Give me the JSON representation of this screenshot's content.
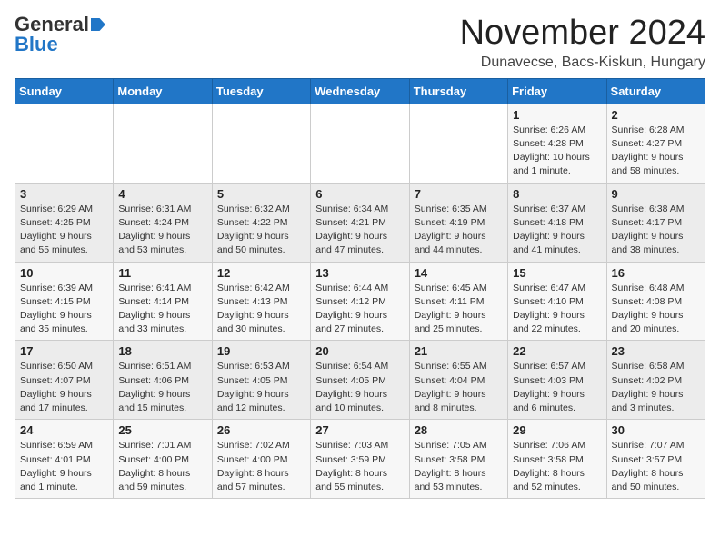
{
  "header": {
    "logo_general": "General",
    "logo_blue": "Blue",
    "month_title": "November 2024",
    "location": "Dunavecse, Bacs-Kiskun, Hungary"
  },
  "calendar": {
    "days_of_week": [
      "Sunday",
      "Monday",
      "Tuesday",
      "Wednesday",
      "Thursday",
      "Friday",
      "Saturday"
    ],
    "weeks": [
      [
        {
          "day": "",
          "info": ""
        },
        {
          "day": "",
          "info": ""
        },
        {
          "day": "",
          "info": ""
        },
        {
          "day": "",
          "info": ""
        },
        {
          "day": "",
          "info": ""
        },
        {
          "day": "1",
          "info": "Sunrise: 6:26 AM\nSunset: 4:28 PM\nDaylight: 10 hours\nand 1 minute."
        },
        {
          "day": "2",
          "info": "Sunrise: 6:28 AM\nSunset: 4:27 PM\nDaylight: 9 hours\nand 58 minutes."
        }
      ],
      [
        {
          "day": "3",
          "info": "Sunrise: 6:29 AM\nSunset: 4:25 PM\nDaylight: 9 hours\nand 55 minutes."
        },
        {
          "day": "4",
          "info": "Sunrise: 6:31 AM\nSunset: 4:24 PM\nDaylight: 9 hours\nand 53 minutes."
        },
        {
          "day": "5",
          "info": "Sunrise: 6:32 AM\nSunset: 4:22 PM\nDaylight: 9 hours\nand 50 minutes."
        },
        {
          "day": "6",
          "info": "Sunrise: 6:34 AM\nSunset: 4:21 PM\nDaylight: 9 hours\nand 47 minutes."
        },
        {
          "day": "7",
          "info": "Sunrise: 6:35 AM\nSunset: 4:19 PM\nDaylight: 9 hours\nand 44 minutes."
        },
        {
          "day": "8",
          "info": "Sunrise: 6:37 AM\nSunset: 4:18 PM\nDaylight: 9 hours\nand 41 minutes."
        },
        {
          "day": "9",
          "info": "Sunrise: 6:38 AM\nSunset: 4:17 PM\nDaylight: 9 hours\nand 38 minutes."
        }
      ],
      [
        {
          "day": "10",
          "info": "Sunrise: 6:39 AM\nSunset: 4:15 PM\nDaylight: 9 hours\nand 35 minutes."
        },
        {
          "day": "11",
          "info": "Sunrise: 6:41 AM\nSunset: 4:14 PM\nDaylight: 9 hours\nand 33 minutes."
        },
        {
          "day": "12",
          "info": "Sunrise: 6:42 AM\nSunset: 4:13 PM\nDaylight: 9 hours\nand 30 minutes."
        },
        {
          "day": "13",
          "info": "Sunrise: 6:44 AM\nSunset: 4:12 PM\nDaylight: 9 hours\nand 27 minutes."
        },
        {
          "day": "14",
          "info": "Sunrise: 6:45 AM\nSunset: 4:11 PM\nDaylight: 9 hours\nand 25 minutes."
        },
        {
          "day": "15",
          "info": "Sunrise: 6:47 AM\nSunset: 4:10 PM\nDaylight: 9 hours\nand 22 minutes."
        },
        {
          "day": "16",
          "info": "Sunrise: 6:48 AM\nSunset: 4:08 PM\nDaylight: 9 hours\nand 20 minutes."
        }
      ],
      [
        {
          "day": "17",
          "info": "Sunrise: 6:50 AM\nSunset: 4:07 PM\nDaylight: 9 hours\nand 17 minutes."
        },
        {
          "day": "18",
          "info": "Sunrise: 6:51 AM\nSunset: 4:06 PM\nDaylight: 9 hours\nand 15 minutes."
        },
        {
          "day": "19",
          "info": "Sunrise: 6:53 AM\nSunset: 4:05 PM\nDaylight: 9 hours\nand 12 minutes."
        },
        {
          "day": "20",
          "info": "Sunrise: 6:54 AM\nSunset: 4:05 PM\nDaylight: 9 hours\nand 10 minutes."
        },
        {
          "day": "21",
          "info": "Sunrise: 6:55 AM\nSunset: 4:04 PM\nDaylight: 9 hours\nand 8 minutes."
        },
        {
          "day": "22",
          "info": "Sunrise: 6:57 AM\nSunset: 4:03 PM\nDaylight: 9 hours\nand 6 minutes."
        },
        {
          "day": "23",
          "info": "Sunrise: 6:58 AM\nSunset: 4:02 PM\nDaylight: 9 hours\nand 3 minutes."
        }
      ],
      [
        {
          "day": "24",
          "info": "Sunrise: 6:59 AM\nSunset: 4:01 PM\nDaylight: 9 hours\nand 1 minute."
        },
        {
          "day": "25",
          "info": "Sunrise: 7:01 AM\nSunset: 4:00 PM\nDaylight: 8 hours\nand 59 minutes."
        },
        {
          "day": "26",
          "info": "Sunrise: 7:02 AM\nSunset: 4:00 PM\nDaylight: 8 hours\nand 57 minutes."
        },
        {
          "day": "27",
          "info": "Sunrise: 7:03 AM\nSunset: 3:59 PM\nDaylight: 8 hours\nand 55 minutes."
        },
        {
          "day": "28",
          "info": "Sunrise: 7:05 AM\nSunset: 3:58 PM\nDaylight: 8 hours\nand 53 minutes."
        },
        {
          "day": "29",
          "info": "Sunrise: 7:06 AM\nSunset: 3:58 PM\nDaylight: 8 hours\nand 52 minutes."
        },
        {
          "day": "30",
          "info": "Sunrise: 7:07 AM\nSunset: 3:57 PM\nDaylight: 8 hours\nand 50 minutes."
        }
      ]
    ]
  }
}
